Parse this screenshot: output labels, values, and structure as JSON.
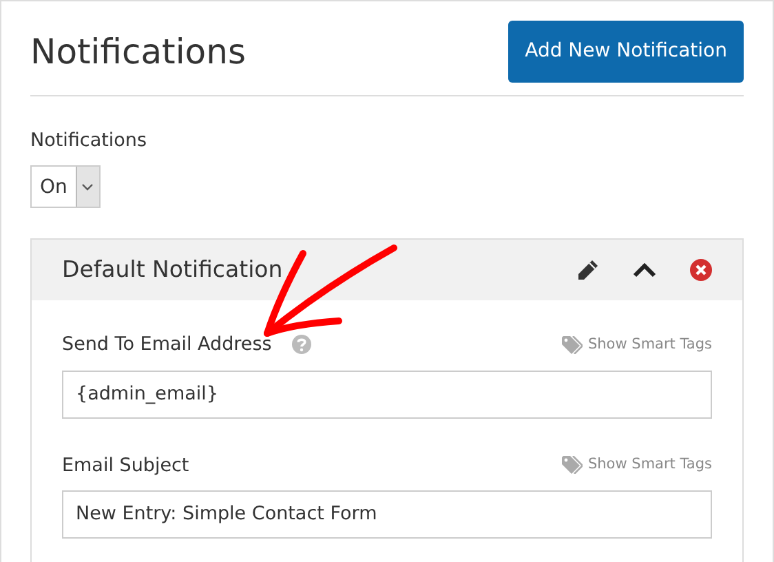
{
  "header": {
    "title": "Notifications",
    "button": "Add New Notification"
  },
  "toggle": {
    "label": "Notifications",
    "value": "On"
  },
  "panel": {
    "title": "Default Notification",
    "expanded": true,
    "fields": [
      {
        "label": "Send To Email Address",
        "help": true,
        "smart_tags": "Show Smart Tags",
        "value": "{admin_email}"
      },
      {
        "label": "Email Subject",
        "help": false,
        "smart_tags": "Show Smart Tags",
        "value": "New Entry: Simple Contact Form"
      }
    ]
  },
  "annotations": [
    {
      "kind": "arrow"
    }
  ]
}
